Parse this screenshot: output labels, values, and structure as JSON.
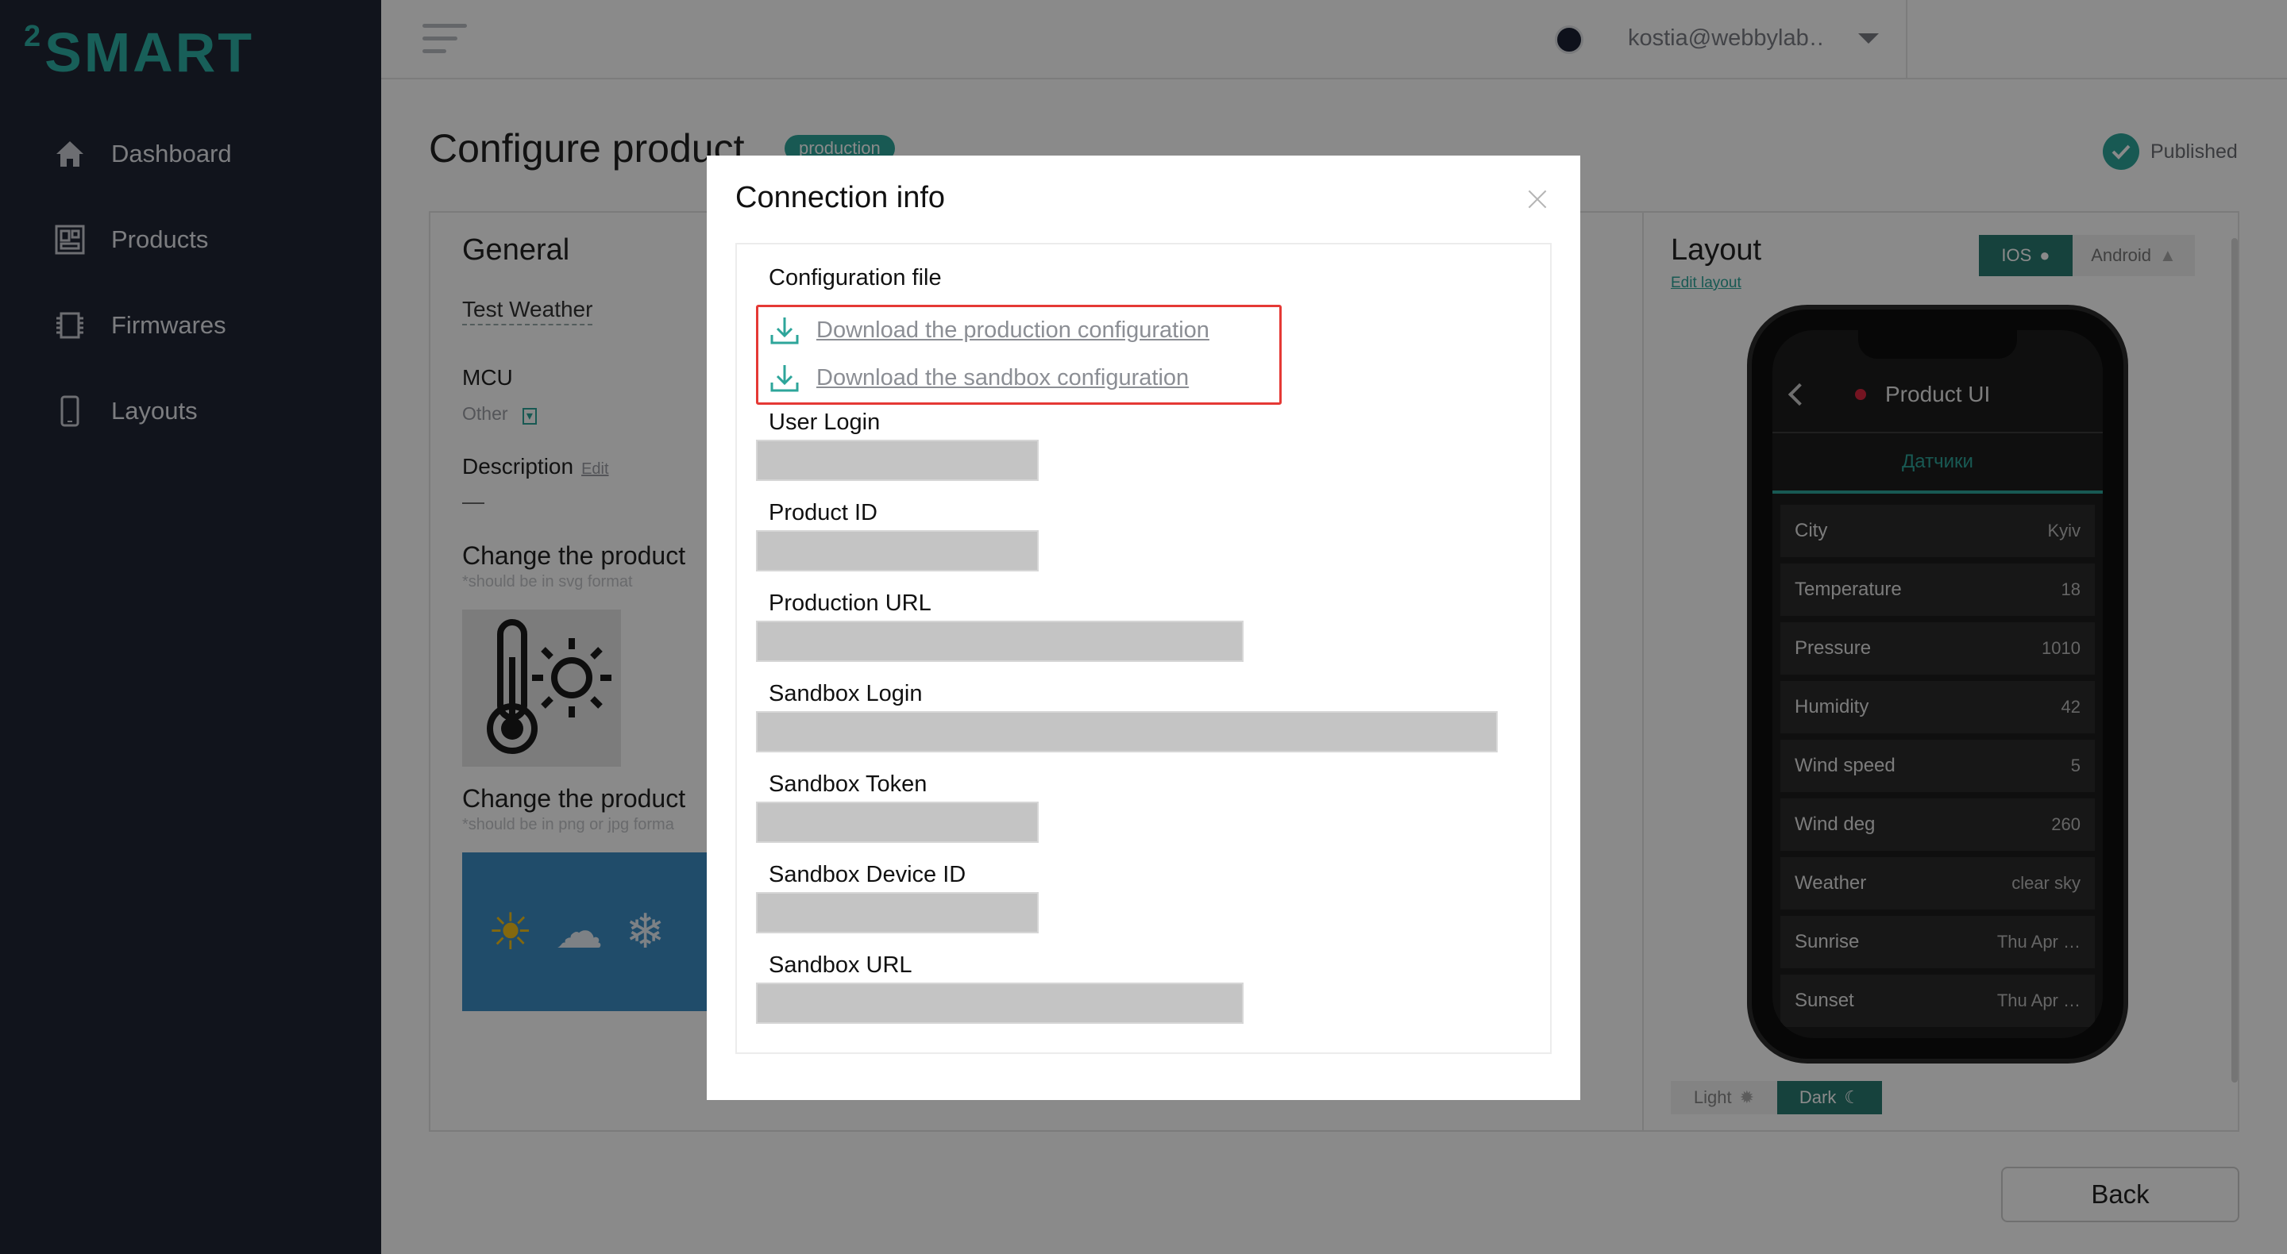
{
  "sidebar": {
    "logo_super": "2",
    "logo_text": "SMART",
    "items": [
      {
        "label": "Dashboard",
        "icon": "home-icon"
      },
      {
        "label": "Products",
        "icon": "products-icon"
      },
      {
        "label": "Firmwares",
        "icon": "chip-icon"
      },
      {
        "label": "Layouts",
        "icon": "phone-icon"
      }
    ]
  },
  "header": {
    "user_email": "kostia@webbylab…"
  },
  "page": {
    "title": "Configure product",
    "env_badge": "production",
    "status": "Published",
    "general": {
      "title": "General",
      "product_name": "Test Weather",
      "mcu_label": "MCU",
      "mcu_value": "Other",
      "description_label": "Description",
      "description_edit": "Edit",
      "description_value": "—",
      "change_icon_title": "Change the product",
      "change_icon_hint": "*should be in svg format",
      "change_bg_title": "Change the product",
      "change_bg_hint": "*should be in png or jpg forma"
    },
    "layout": {
      "title": "Layout",
      "edit_link": "Edit layout",
      "os_options": [
        "IOS",
        "Android"
      ],
      "selected_os": "IOS",
      "themes": [
        "Light",
        "Dark"
      ],
      "selected_theme": "Dark",
      "phone": {
        "title": "Product UI",
        "tab": "Датчики",
        "rows": [
          {
            "key": "City",
            "value": "Kyiv"
          },
          {
            "key": "Temperature",
            "value": "18"
          },
          {
            "key": "Pressure",
            "value": "1010"
          },
          {
            "key": "Humidity",
            "value": "42"
          },
          {
            "key": "Wind speed",
            "value": "5"
          },
          {
            "key": "Wind deg",
            "value": "260"
          },
          {
            "key": "Weather",
            "value": "clear sky"
          },
          {
            "key": "Sunrise",
            "value": "Thu Apr …"
          },
          {
            "key": "Sunset",
            "value": "Thu Apr …"
          }
        ]
      }
    },
    "back_label": "Back"
  },
  "modal": {
    "title": "Connection info",
    "config_file_label": "Configuration file",
    "download_production": "Download the production configuration",
    "download_sandbox": "Download the sandbox configuration",
    "fields": [
      {
        "label": "User Login"
      },
      {
        "label": "Product ID"
      },
      {
        "label": "Production URL"
      },
      {
        "label": "Sandbox Login"
      },
      {
        "label": "Sandbox Token"
      },
      {
        "label": "Sandbox Device ID"
      },
      {
        "label": "Sandbox URL"
      }
    ]
  },
  "colors": {
    "sidebar_bg": "#202534",
    "accent": "#2da59a",
    "highlight_border": "#e53935"
  }
}
